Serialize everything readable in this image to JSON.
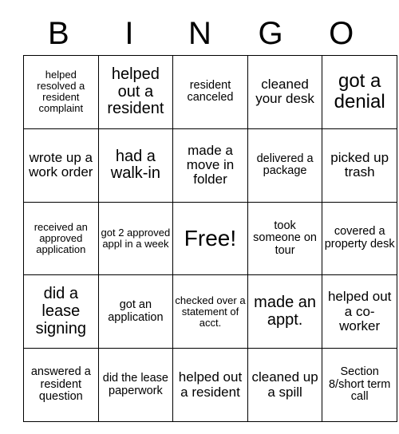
{
  "card": {
    "header_letters": [
      "B",
      "I",
      "N",
      "G",
      "O"
    ],
    "background_color": "#ffffff",
    "border_color": "#000000",
    "text_color": "#000000",
    "rows": [
      [
        {
          "text": "helped resolved a resident complaint",
          "size": "fs-xs"
        },
        {
          "text": "helped out a resident",
          "size": "fs-lg"
        },
        {
          "text": "resident canceled",
          "size": "fs-sm"
        },
        {
          "text": "cleaned your desk",
          "size": "fs-md"
        },
        {
          "text": "got a denial",
          "size": "fs-xl"
        }
      ],
      [
        {
          "text": "wrote up a work order",
          "size": "fs-md"
        },
        {
          "text": "had a walk-in",
          "size": "fs-lg"
        },
        {
          "text": "made a move in folder",
          "size": "fs-md"
        },
        {
          "text": "delivered a package",
          "size": "fs-sm"
        },
        {
          "text": "picked up trash",
          "size": "fs-md"
        }
      ],
      [
        {
          "text": "received an approved application",
          "size": "fs-xs"
        },
        {
          "text": "got 2 approved appl in a week",
          "size": "fs-xs"
        },
        {
          "text": "Free!",
          "size": "fs-free"
        },
        {
          "text": "took someone on tour",
          "size": "fs-sm"
        },
        {
          "text": "covered a property desk",
          "size": "fs-sm"
        }
      ],
      [
        {
          "text": "did a lease signing",
          "size": "fs-lg"
        },
        {
          "text": "got an application",
          "size": "fs-sm"
        },
        {
          "text": "checked over a statement of acct.",
          "size": "fs-xs"
        },
        {
          "text": "made an appt.",
          "size": "fs-lg"
        },
        {
          "text": "helped out a co-worker",
          "size": "fs-md"
        }
      ],
      [
        {
          "text": "answered a resident question",
          "size": "fs-sm"
        },
        {
          "text": "did the lease paperwork",
          "size": "fs-sm"
        },
        {
          "text": "helped out a resident",
          "size": "fs-md"
        },
        {
          "text": "cleaned up a spill",
          "size": "fs-md"
        },
        {
          "text": "Section 8/short term call",
          "size": "fs-sm"
        }
      ]
    ]
  }
}
